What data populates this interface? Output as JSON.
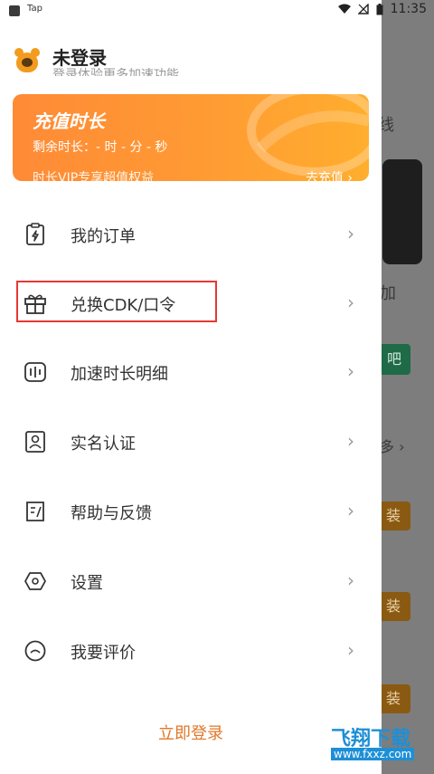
{
  "status_bar": {
    "app": "Tap",
    "time": "11:35"
  },
  "user": {
    "name": "未登录",
    "subtitle": "登录体验更多加速功能"
  },
  "vip_card": {
    "title": "充值时长",
    "remaining": "剩余时长：- 时 - 分 - 秒",
    "description": "时长VIP专享超值权益",
    "recharge_link": "去充值 ›"
  },
  "menu": [
    {
      "label": "我的订单",
      "icon": "clipboard-lightning-icon"
    },
    {
      "label": "兑换CDK/口令",
      "icon": "gift-icon"
    },
    {
      "label": "加速时长明细",
      "icon": "waveform-icon"
    },
    {
      "label": "实名认证",
      "icon": "id-card-icon"
    },
    {
      "label": "帮助与反馈",
      "icon": "feedback-doc-icon"
    },
    {
      "label": "设置",
      "icon": "hexagon-settings-icon"
    },
    {
      "label": "我要评价",
      "icon": "face-icon"
    }
  ],
  "menu_arrow": "›",
  "login_link": "立即登录",
  "background": {
    "fragment_1": "线",
    "fragment_2": "加",
    "fragment_3": "多 ›",
    "green_button": "吧",
    "btn_1": "装",
    "btn_2": "装",
    "btn_3": "装"
  },
  "watermark": {
    "text": "飞翔下载",
    "url": "www.fxxz.com"
  },
  "colors": {
    "accent": "#ff8a36",
    "link": "#e0782a",
    "highlight": "#e53935"
  }
}
